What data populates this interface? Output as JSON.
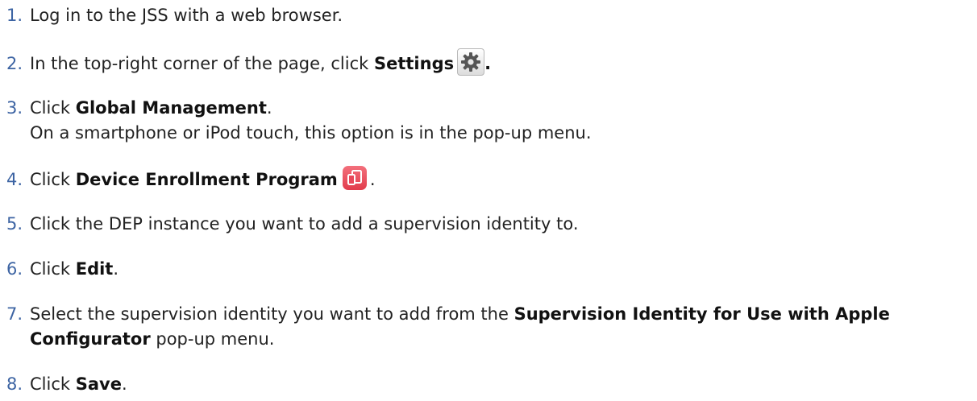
{
  "steps": [
    {
      "num": "1.",
      "text": "Log in to the JSS with a web browser."
    },
    {
      "num": "2.",
      "pre": "In the top-right corner of the page, click ",
      "bold": "Settings",
      "icon": "gear-icon",
      "post": "."
    },
    {
      "num": "3.",
      "pre": "Click ",
      "bold": "Global Management",
      "post": ".",
      "line2": "On a smartphone or iPod touch, this option is in the pop-up menu."
    },
    {
      "num": "4.",
      "pre": "Click ",
      "bold": "Device Enrollment Program",
      "icon": "device-enrollment-icon",
      "post": "."
    },
    {
      "num": "5.",
      "text": "Click the DEP instance you want to add a supervision identity to."
    },
    {
      "num": "6.",
      "pre": "Click ",
      "bold": "Edit",
      "post": "."
    },
    {
      "num": "7.",
      "pre": "Select the supervision identity you want to add from the ",
      "bold": "Supervision Identity for Use with Apple",
      "bold2": "Configurator",
      "post": " pop-up menu."
    },
    {
      "num": "8.",
      "pre": "Click ",
      "bold": "Save",
      "post": "."
    }
  ],
  "colors": {
    "step_number": "#3d64a3",
    "dep_icon": "#e8485a"
  }
}
